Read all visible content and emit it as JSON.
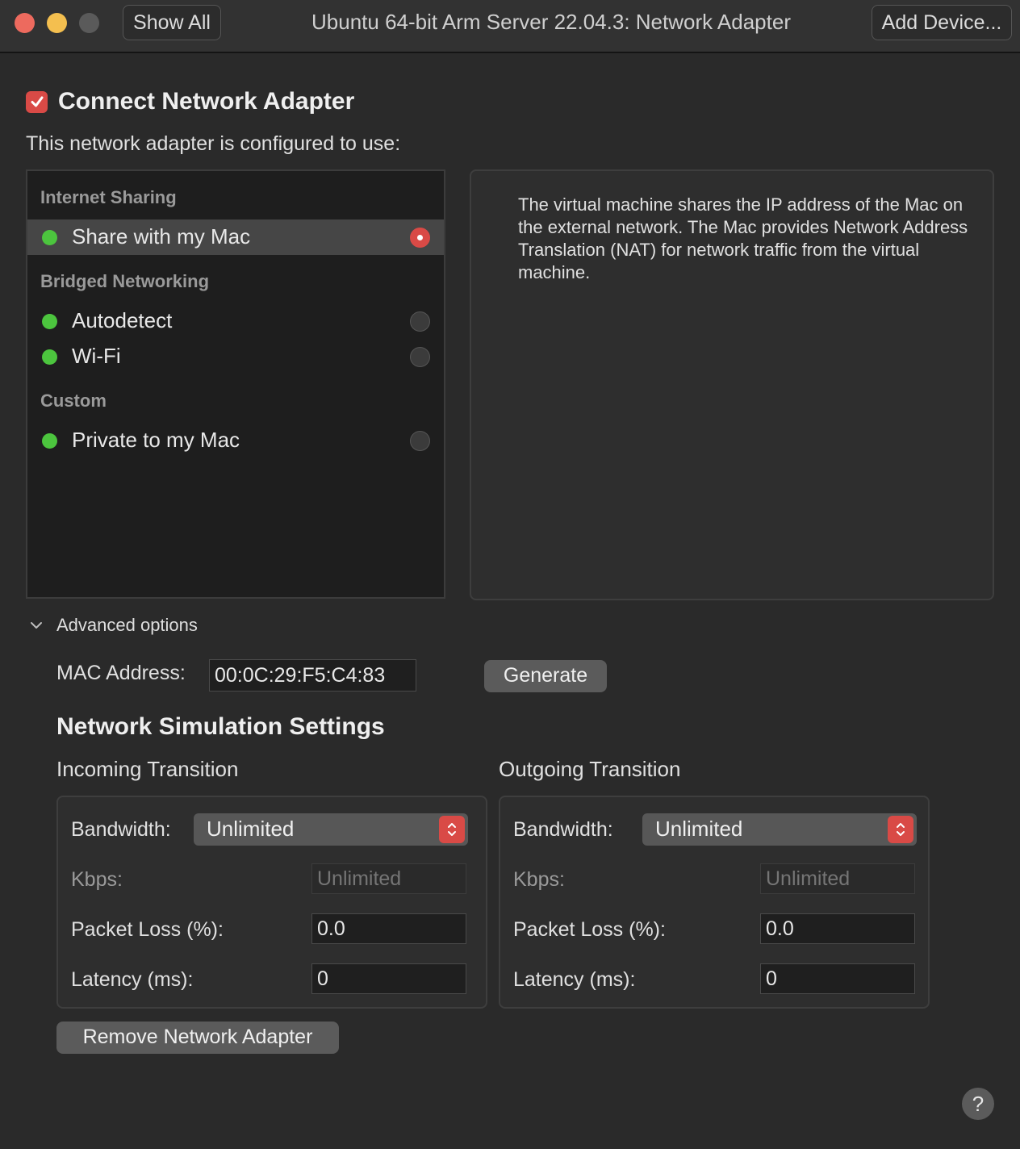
{
  "titlebar": {
    "show_all_label": "Show All",
    "title": "Ubuntu 64-bit Arm Server 22.04.3: Network Adapter",
    "add_device_label": "Add Device..."
  },
  "connect": {
    "label": "Connect Network Adapter",
    "checked": true
  },
  "configured_label": "This network adapter is configured to use:",
  "network_list": {
    "sections": [
      {
        "header": "Internet Sharing",
        "items": [
          {
            "label": "Share with my Mac",
            "selected": true
          }
        ]
      },
      {
        "header": "Bridged Networking",
        "items": [
          {
            "label": "Autodetect",
            "selected": false
          },
          {
            "label": "Wi-Fi",
            "selected": false
          }
        ]
      },
      {
        "header": "Custom",
        "items": [
          {
            "label": "Private to my Mac",
            "selected": false
          }
        ]
      }
    ]
  },
  "description": "The virtual machine shares the IP address of the Mac on the external network. The Mac provides Network Address Translation (NAT) for network traffic from the virtual machine.",
  "advanced": {
    "label": "Advanced options",
    "mac_label": "MAC Address:",
    "mac_value": "00:0C:29:F5:C4:83",
    "generate_label": "Generate"
  },
  "simulation": {
    "title": "Network Simulation Settings",
    "incoming": {
      "title": "Incoming Transition",
      "bandwidth_label": "Bandwidth:",
      "bandwidth_value": "Unlimited",
      "kbps_label": "Kbps:",
      "kbps_placeholder": "Unlimited",
      "packet_loss_label": "Packet Loss (%):",
      "packet_loss_value": "0.0",
      "latency_label": "Latency (ms):",
      "latency_value": "0"
    },
    "outgoing": {
      "title": "Outgoing Transition",
      "bandwidth_label": "Bandwidth:",
      "bandwidth_value": "Unlimited",
      "kbps_label": "Kbps:",
      "kbps_placeholder": "Unlimited",
      "packet_loss_label": "Packet Loss (%):",
      "packet_loss_value": "0.0",
      "latency_label": "Latency (ms):",
      "latency_value": "0"
    }
  },
  "remove_label": "Remove Network Adapter",
  "help_label": "?",
  "colors": {
    "accent": "#d94a46",
    "status_green": "#4cc53e",
    "background": "#2a2a2a"
  }
}
